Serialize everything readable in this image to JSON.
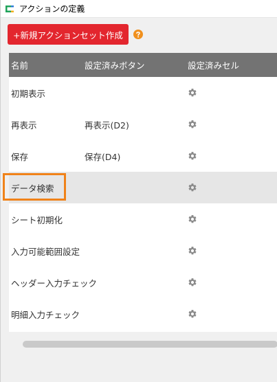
{
  "window": {
    "title": "アクションの定義"
  },
  "toolbar": {
    "new_button_label": "+新規アクションセット作成",
    "help_icon": "help-circle-icon"
  },
  "grid": {
    "columns": [
      "名前",
      "設定済みボタン",
      "設定済みセル"
    ],
    "rows": [
      {
        "name": "初期表示",
        "button": "",
        "cell_icon": "gear-icon"
      },
      {
        "name": "再表示",
        "button": "再表示(D2)",
        "cell_icon": "gear-icon"
      },
      {
        "name": "保存",
        "button": "保存(D4)",
        "cell_icon": "gear-icon"
      },
      {
        "name": "データ検索",
        "button": "",
        "cell_icon": "gear-icon",
        "selected": true
      },
      {
        "name": "シート初期化",
        "button": "",
        "cell_icon": "gear-icon"
      },
      {
        "name": "入力可能範囲設定",
        "button": "",
        "cell_icon": "gear-icon"
      },
      {
        "name": "ヘッダー入力チェック",
        "button": "",
        "cell_icon": "gear-icon"
      },
      {
        "name": "明細入力チェック",
        "button": "",
        "cell_icon": "gear-icon"
      }
    ]
  },
  "colors": {
    "accent_red": "#e3262e",
    "header_gray": "#737373",
    "selected_row": "#e6e6e6",
    "highlight_orange": "#f08219",
    "help_orange": "#f0901e",
    "gear_gray": "#8a8a8a"
  }
}
